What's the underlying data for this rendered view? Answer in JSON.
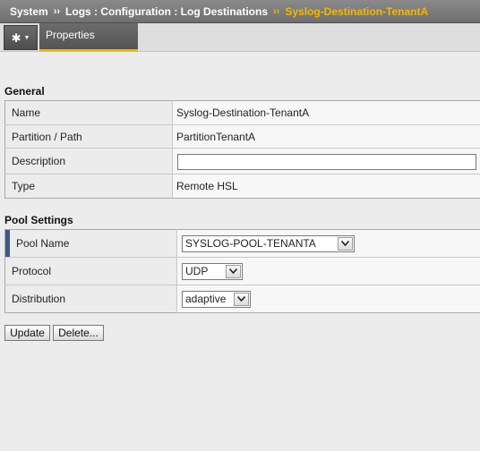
{
  "breadcrumb": {
    "items": [
      "System",
      "Logs : Configuration : Log Destinations"
    ],
    "separator": "››",
    "current": "Syslog-Destination-TenantA"
  },
  "toolbar": {
    "gear_icon": "gear-icon",
    "gear_glyph": "✱",
    "caret_glyph": "▼",
    "tab_label": "Properties"
  },
  "general": {
    "title": "General",
    "rows": [
      {
        "label": "Name",
        "value": "Syslog-Destination-TenantA"
      },
      {
        "label": "Partition / Path",
        "value": "PartitionTenantA"
      },
      {
        "label": "Description",
        "value": ""
      },
      {
        "label": "Type",
        "value": "Remote HSL"
      }
    ]
  },
  "pool_settings": {
    "title": "Pool Settings",
    "rows": [
      {
        "label": "Pool Name",
        "value": "SYSLOG-POOL-TENANTA"
      },
      {
        "label": "Protocol",
        "value": "UDP"
      },
      {
        "label": "Distribution",
        "value": "adaptive"
      }
    ]
  },
  "buttons": {
    "update": "Update",
    "delete": "Delete..."
  },
  "colors": {
    "accent": "#f5b800",
    "header_bg": "#7d7d7d",
    "page_bg": "#ececec"
  }
}
